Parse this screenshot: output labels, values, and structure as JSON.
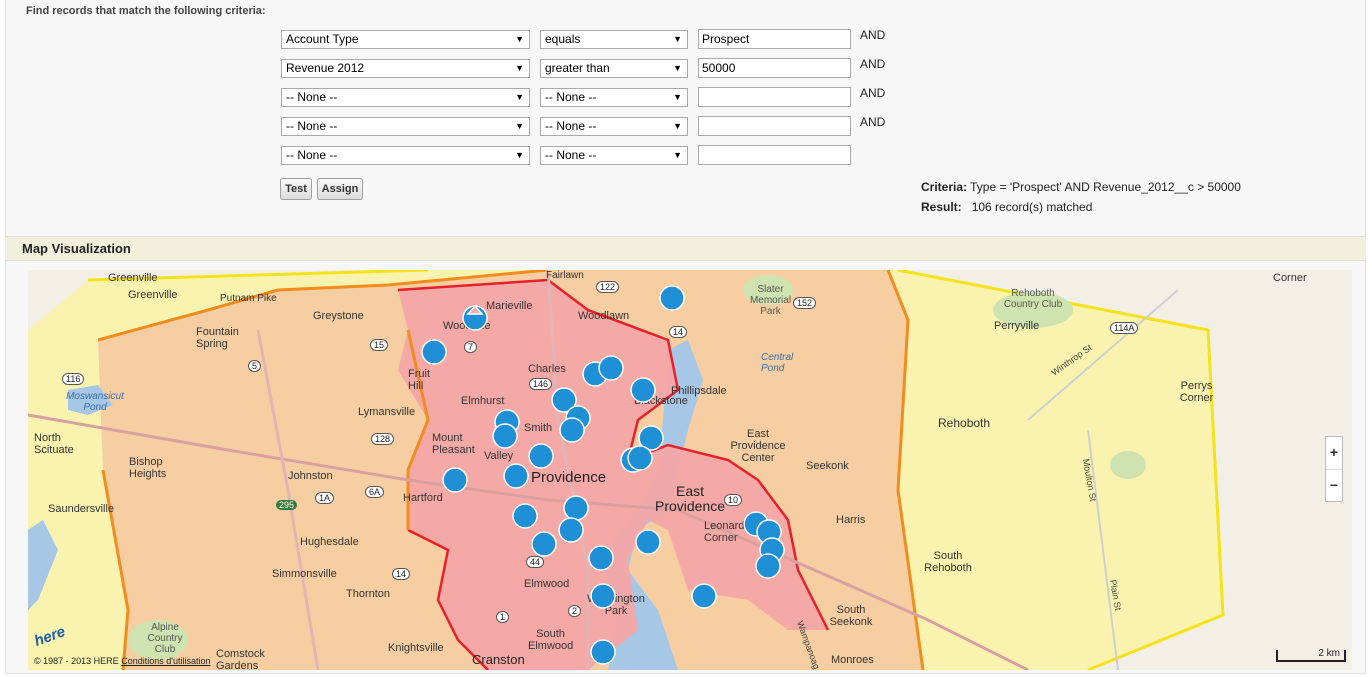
{
  "criteria_heading": "Find records that match the following criteria:",
  "filter_rows": [
    {
      "field": "Account Type",
      "operator": "equals",
      "value": "Prospect",
      "conjunction": "AND"
    },
    {
      "field": "Revenue 2012",
      "operator": "greater than",
      "value": "50000",
      "conjunction": "AND"
    },
    {
      "field": "-- None --",
      "operator": "-- None --",
      "value": "",
      "conjunction": "AND"
    },
    {
      "field": "-- None --",
      "operator": "-- None --",
      "value": "",
      "conjunction": "AND"
    },
    {
      "field": "-- None --",
      "operator": "-- None --",
      "value": "",
      "conjunction": ""
    }
  ],
  "buttons": {
    "test": "Test",
    "assign": "Assign"
  },
  "result": {
    "criteria_label": "Criteria:",
    "criteria_value": "Type = 'Prospect' AND Revenue_2012__c > 50000",
    "result_label": "Result:",
    "result_value": "106 record(s) matched"
  },
  "map_section_title": "Map Visualization",
  "map": {
    "labels": [
      "Greenville",
      "Putnam Pike",
      "Greystone",
      "Fountain Spring",
      "Woodville",
      "Marieville",
      "Woodlawn",
      "Fairlawn",
      "Slater Memorial Park",
      "Central Pond",
      "Phillipsdale",
      "Blackstone",
      "Charles",
      "Fruit Hill",
      "Lymansville",
      "Elmhurst",
      "Smith",
      "Mount Pleasant",
      "Valley",
      "North Scituate",
      "Moswansicut Pond",
      "Bishop Heights",
      "Johnston",
      "Hartford",
      "Providence",
      "East Providence",
      "East Providence Center",
      "Seekonk",
      "Harris",
      "Saundersville",
      "Hughesdale",
      "Simmonsville",
      "Thornton",
      "Elmwood",
      "Washington Park",
      "Leonard Corner",
      "South Seekonk",
      "South Rehoboth",
      "Rehoboth",
      "Rehoboth Country Club",
      "Perryville",
      "Perrys Corner",
      "Winthrop St",
      "Moulton St",
      "Plain St",
      "Alpine Country Club",
      "Comstock Gardens",
      "Knightsville",
      "Cranston",
      "South Elmwood",
      "Monroes",
      "Wampanoag",
      "Corner"
    ],
    "road_numbers": [
      "116",
      "5",
      "15",
      "7",
      "146",
      "122",
      "14",
      "152",
      "128",
      "6A",
      "6",
      "295",
      "1A",
      "10",
      "2",
      "1",
      "44",
      "114A"
    ],
    "zoom_in": "+",
    "zoom_out": "−",
    "copyright": "© 1987 - 2013 HERE",
    "terms_link": "Conditions d'utilisation",
    "scale_label": "2 km",
    "logo": "here",
    "icons": {
      "marker": "map-marker-icon",
      "logo": "here-logo-icon"
    },
    "colors": {
      "providence_region": "#f4a6a6",
      "middle_region": "#f7cba0",
      "outer_region": "#fbf3a8",
      "boundary_red": "#e8202a",
      "boundary_orange": "#f28c1f",
      "boundary_yellow": "#f5e21a",
      "water": "#a7c7e7",
      "marker": "#1f8fd6"
    },
    "marker_count": 30
  }
}
